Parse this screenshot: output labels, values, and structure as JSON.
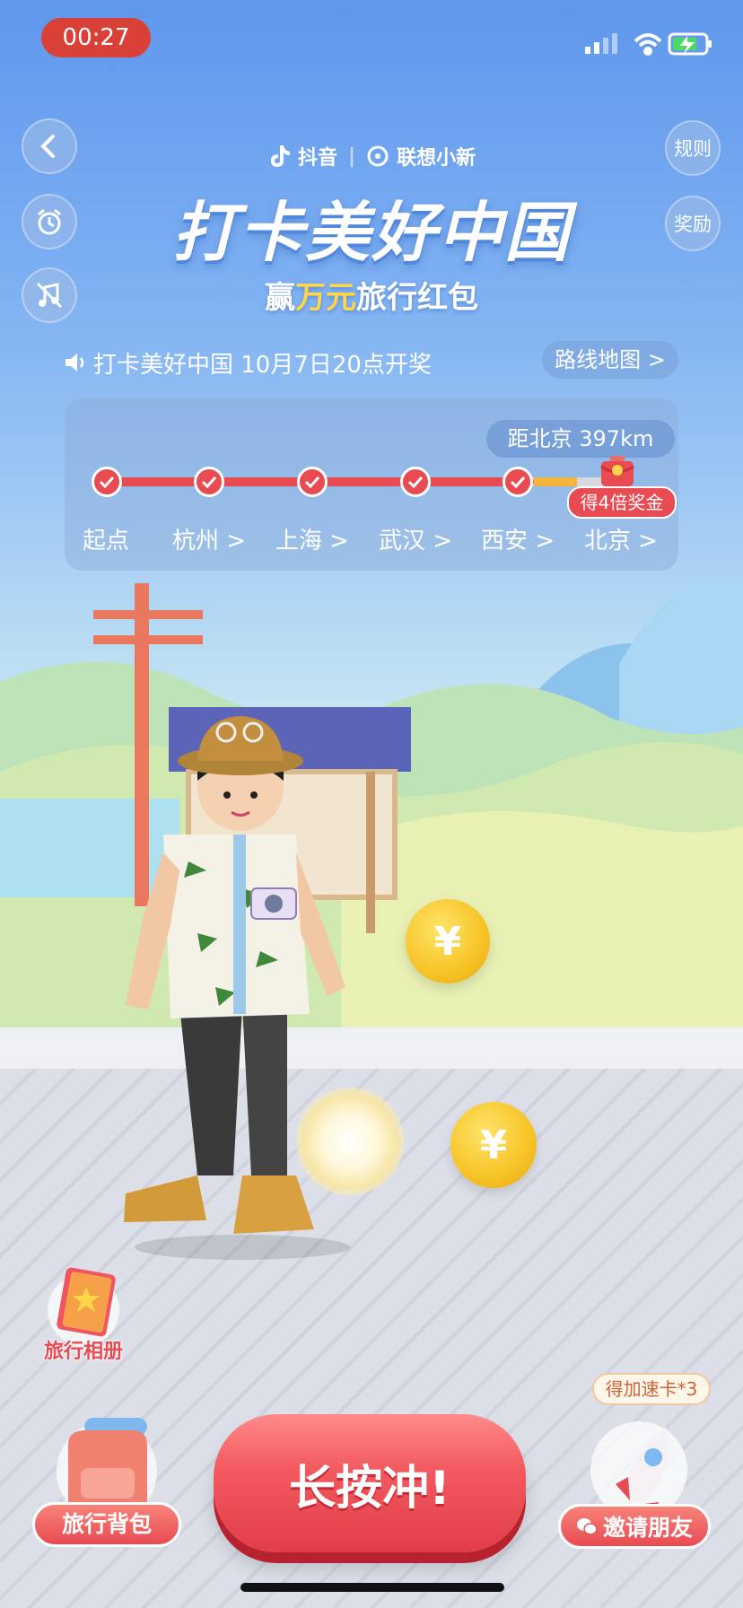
{
  "status": {
    "time": "00:27"
  },
  "header": {
    "brand_douyin": "抖音",
    "brand_lenovo": "联想小新",
    "title": "打卡美好中国",
    "subtitle_pre": "赢",
    "subtitle_highlight": "万元",
    "subtitle_post": "旅行红包",
    "rules_label": "规则",
    "rewards_label": "奖励"
  },
  "notice": {
    "text": "打卡美好中国 10月7日20点开奖",
    "route_map_label": "路线地图 >"
  },
  "route": {
    "distance_label": "距北京 397km",
    "bonus_label": "得4倍奖金",
    "stops": [
      "起点",
      "杭州 >",
      "上海 >",
      "武汉 >",
      "西安 >",
      "北京 >"
    ],
    "completed_count": 5
  },
  "bottom": {
    "album_label": "旅行相册",
    "backpack_label": "旅行背包",
    "dash_label": "长按冲!",
    "invite_label": "邀请朋友",
    "speed_card_label": "得加速卡*3"
  },
  "icons": {
    "back": "back-icon",
    "alarm": "alarm-icon",
    "music_off": "music-off-icon",
    "speaker": "speaker-icon",
    "wechat": "wechat-icon"
  },
  "colors": {
    "primary_red": "#e84b52",
    "status_red": "#d94038",
    "highlight_yellow": "#ffd54a"
  }
}
